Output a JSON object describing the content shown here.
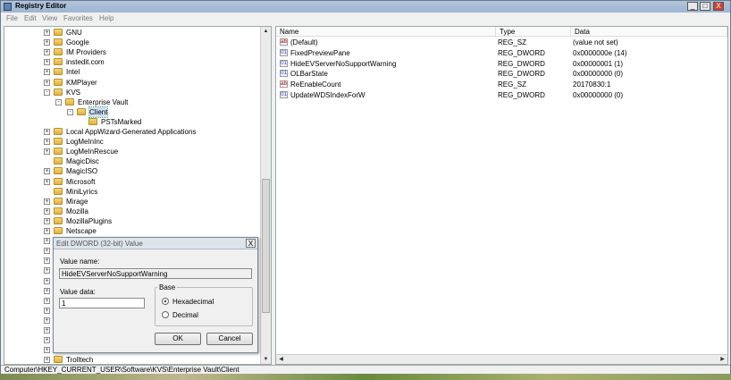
{
  "window": {
    "title": "Registry Editor",
    "controls": {
      "minimize": "_",
      "maximize": "□",
      "close": "X"
    }
  },
  "menu": [
    "File",
    "Edit",
    "View",
    "Favorites",
    "Help"
  ],
  "tree": [
    {
      "label": "GNU",
      "level": 0,
      "expander": "+"
    },
    {
      "label": "Google",
      "level": 0,
      "expander": "+"
    },
    {
      "label": "IM Providers",
      "level": 0,
      "expander": "+"
    },
    {
      "label": "instedit.com",
      "level": 0,
      "expander": "+"
    },
    {
      "label": "Intel",
      "level": 0,
      "expander": "+"
    },
    {
      "label": "KMPlayer",
      "level": 0,
      "expander": "+"
    },
    {
      "label": "KVS",
      "level": 0,
      "expander": "-"
    },
    {
      "label": "Enterprise Vault",
      "level": 1,
      "expander": "-"
    },
    {
      "label": "Client",
      "level": 2,
      "expander": "-",
      "selected": true
    },
    {
      "label": "PSTsMarked",
      "level": 3,
      "expander": ""
    },
    {
      "label": "Local AppWizard-Generated Applications",
      "level": 0,
      "expander": "+"
    },
    {
      "label": "LogMeInInc",
      "level": 0,
      "expander": "+"
    },
    {
      "label": "LogMeInRescue",
      "level": 0,
      "expander": "+"
    },
    {
      "label": "MagicDisc",
      "level": 0,
      "expander": ""
    },
    {
      "label": "MagicISO",
      "level": 0,
      "expander": "+"
    },
    {
      "label": "Microsoft",
      "level": 0,
      "expander": "+"
    },
    {
      "label": "MiniLyrics",
      "level": 0,
      "expander": ""
    },
    {
      "label": "Mirage",
      "level": 0,
      "expander": "+"
    },
    {
      "label": "Mozilla",
      "level": 0,
      "expander": "+"
    },
    {
      "label": "MozillaPlugins",
      "level": 0,
      "expander": "+"
    },
    {
      "label": "Netscape",
      "level": 0,
      "expander": "+"
    },
    {
      "label": "",
      "level": 0,
      "expander": "+"
    },
    {
      "label": "",
      "level": 0,
      "expander": "+"
    },
    {
      "label": "",
      "level": 0,
      "expander": "+"
    },
    {
      "label": "",
      "level": 0,
      "expander": "+"
    },
    {
      "label": "",
      "level": 0,
      "expander": "+"
    },
    {
      "label": "",
      "level": 0,
      "expander": "+"
    },
    {
      "label": "",
      "level": 0,
      "expander": "+"
    },
    {
      "label": "",
      "level": 0,
      "expander": "+"
    },
    {
      "label": "",
      "level": 0,
      "expander": "+"
    },
    {
      "label": "",
      "level": 0,
      "expander": "+"
    },
    {
      "label": "",
      "level": 0,
      "expander": "+"
    },
    {
      "label": "",
      "level": 0,
      "expander": "+"
    },
    {
      "label": "Trolltech",
      "level": 0,
      "expander": "+"
    }
  ],
  "columns": {
    "name": "Name",
    "type": "Type",
    "data": "Data"
  },
  "values": [
    {
      "icon": "ab",
      "name": "(Default)",
      "type": "REG_SZ",
      "data": "(value not set)"
    },
    {
      "icon": "bin",
      "name": "FixedPreviewPane",
      "type": "REG_DWORD",
      "data": "0x0000000e (14)"
    },
    {
      "icon": "bin",
      "name": "HideEVServerNoSupportWarning",
      "type": "REG_DWORD",
      "data": "0x00000001 (1)"
    },
    {
      "icon": "bin",
      "name": "OLBarState",
      "type": "REG_DWORD",
      "data": "0x00000000 (0)"
    },
    {
      "icon": "ab",
      "name": "ReEnableCount",
      "type": "REG_SZ",
      "data": "20170830:1"
    },
    {
      "icon": "bin",
      "name": "UpdateWDSIndexForW",
      "type": "REG_DWORD",
      "data": "0x00000000 (0)"
    }
  ],
  "status": "Computer\\HKEY_CURRENT_USER\\Software\\KVS\\Enterprise Vault\\Client",
  "dialog": {
    "title": "Edit DWORD (32-bit) Value",
    "value_name_label": "Value name:",
    "value_name": "HideEVServerNoSupportWarning",
    "value_data_label": "Value data:",
    "value_data": "1",
    "base_label": "Base",
    "hex_label": "Hexadecimal",
    "dec_label": "Decimal",
    "selected_base": "Hexadecimal",
    "ok": "OK",
    "cancel": "Cancel",
    "close": "X"
  }
}
